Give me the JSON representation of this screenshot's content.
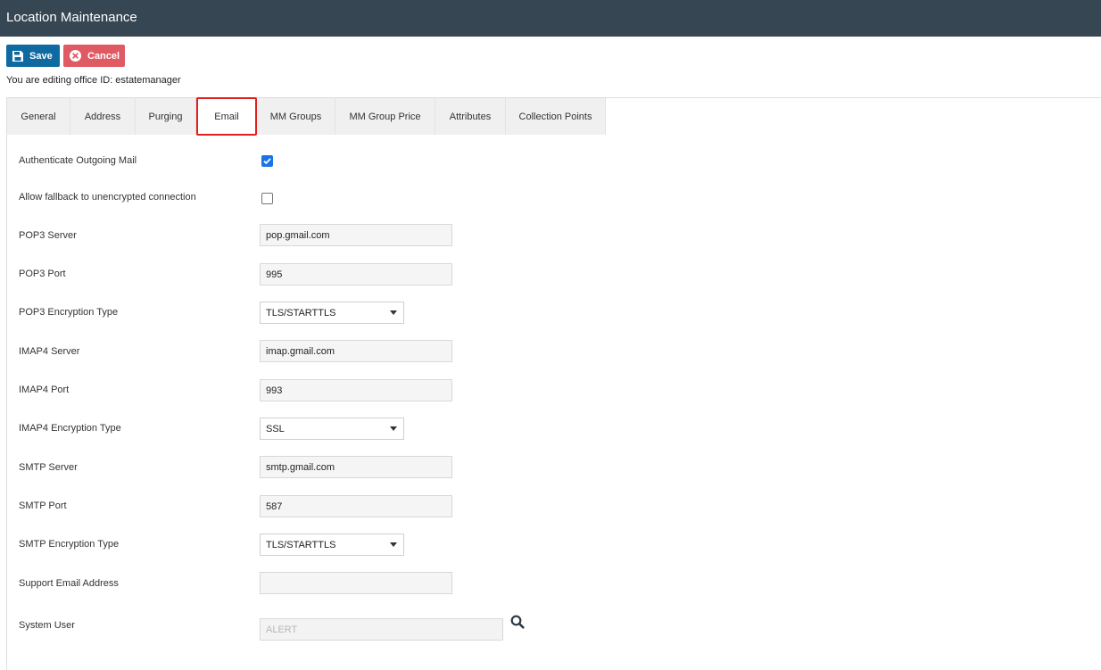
{
  "window": {
    "title": "Location Maintenance"
  },
  "toolbar": {
    "save_label": "Save",
    "cancel_label": "Cancel"
  },
  "editing_note": "You are editing office ID: estatemanager",
  "tabs": [
    {
      "label": "General"
    },
    {
      "label": "Address"
    },
    {
      "label": "Purging"
    },
    {
      "label": "Email"
    },
    {
      "label": "MM Groups"
    },
    {
      "label": "MM Group Price"
    },
    {
      "label": "Attributes"
    },
    {
      "label": "Collection Points"
    }
  ],
  "active_tab": "Email",
  "form": {
    "authenticate_outgoing_mail": {
      "label": "Authenticate Outgoing Mail",
      "checked": true
    },
    "allow_fallback": {
      "label": "Allow fallback to unencrypted connection",
      "checked": false
    },
    "pop3_server": {
      "label": "POP3 Server",
      "value": "pop.gmail.com"
    },
    "pop3_port": {
      "label": "POP3 Port",
      "value": "995"
    },
    "pop3_encryption": {
      "label": "POP3 Encryption Type",
      "value": "TLS/STARTTLS"
    },
    "imap4_server": {
      "label": "IMAP4 Server",
      "value": "imap.gmail.com"
    },
    "imap4_port": {
      "label": "IMAP4 Port",
      "value": "993"
    },
    "imap4_encryption": {
      "label": "IMAP4 Encryption Type",
      "value": "SSL"
    },
    "smtp_server": {
      "label": "SMTP Server",
      "value": "smtp.gmail.com"
    },
    "smtp_port": {
      "label": "SMTP Port",
      "value": "587"
    },
    "smtp_encryption": {
      "label": "SMTP Encryption Type",
      "value": "TLS/STARTTLS"
    },
    "support_email": {
      "label": "Support Email Address",
      "value": ""
    },
    "system_user": {
      "label": "System User",
      "value": "ALERT"
    }
  },
  "icons": {
    "save": "floppy-disk-icon",
    "cancel": "close-circle-icon",
    "lookup": "search-icon"
  },
  "colors": {
    "titlebar": "#364652",
    "save_button": "#0e6aa0",
    "cancel_button": "#e05a64",
    "active_tab_border": "#e0201f",
    "checkbox_checked": "#1a73e8"
  }
}
